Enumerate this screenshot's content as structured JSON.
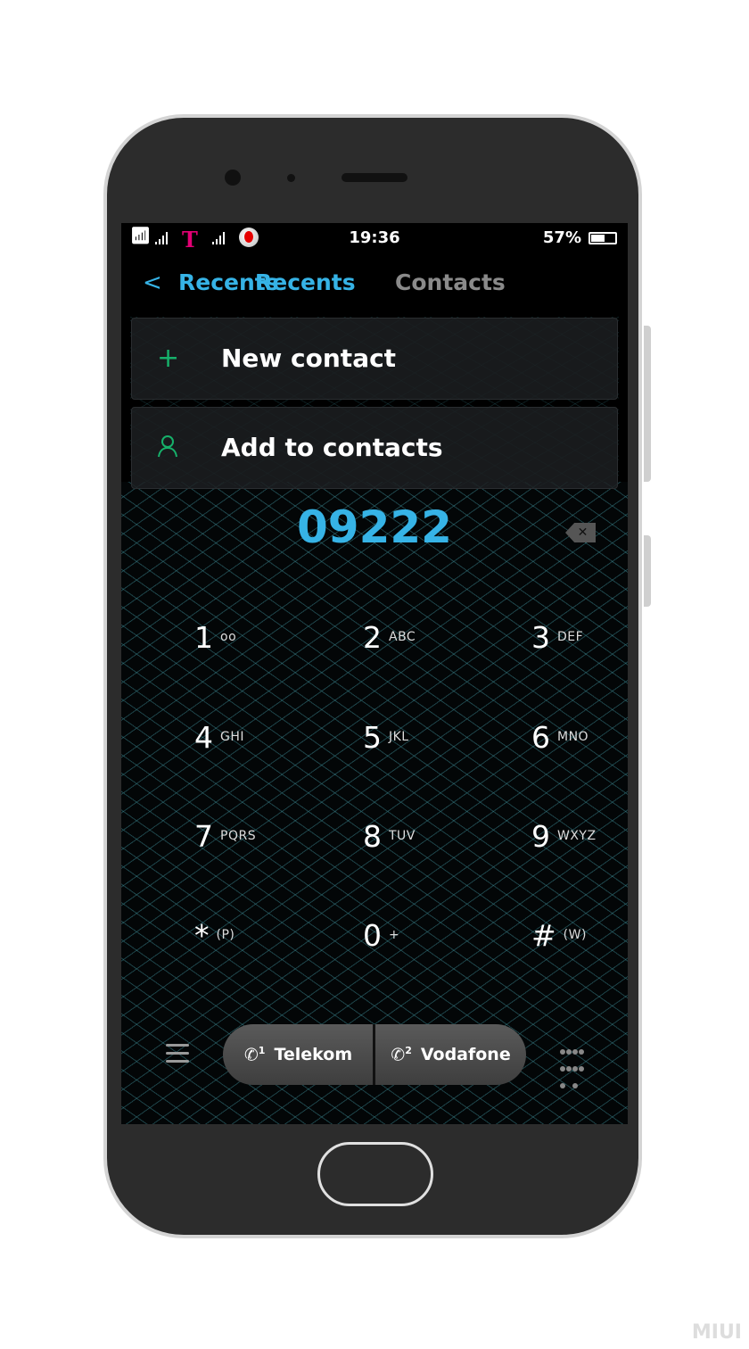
{
  "status_bar": {
    "time": "19:36",
    "battery_percent": "57%",
    "battery_level": 0.57,
    "carrier_logo": "T",
    "icons": [
      "wifi-icon",
      "signal-icon",
      "telekom-logo",
      "signal-icon",
      "vodafone-logo"
    ]
  },
  "tabs": {
    "back_icon": "chevron-left-icon",
    "active": "Recents",
    "active_overlap": "Recents",
    "inactive": "Contacts"
  },
  "actions": [
    {
      "icon": "plus-icon",
      "label": "New contact"
    },
    {
      "icon": "person-icon",
      "label": "Add to contacts"
    }
  ],
  "dialer": {
    "number": "09222",
    "delete_icon": "backspace-icon",
    "keys": [
      {
        "d": "1",
        "l": "ᴏᴏ"
      },
      {
        "d": "2",
        "l": "ABC"
      },
      {
        "d": "3",
        "l": "DEF"
      },
      {
        "d": "4",
        "l": "GHI"
      },
      {
        "d": "5",
        "l": "JKL"
      },
      {
        "d": "6",
        "l": "MNO"
      },
      {
        "d": "7",
        "l": "PQRS"
      },
      {
        "d": "8",
        "l": "TUV"
      },
      {
        "d": "9",
        "l": "WXYZ"
      },
      {
        "d": "*",
        "l": "(P)"
      },
      {
        "d": "0",
        "l": "+"
      },
      {
        "d": "#",
        "l": "(W)"
      }
    ]
  },
  "call_buttons": [
    {
      "sim": "1",
      "label": "Telekom"
    },
    {
      "sim": "2",
      "label": "Vodafone"
    }
  ],
  "colors": {
    "accent": "#36b3e6",
    "green": "#16b06a",
    "telekom": "#e20074",
    "vodafone": "#e60000"
  },
  "watermark": "MIUI"
}
